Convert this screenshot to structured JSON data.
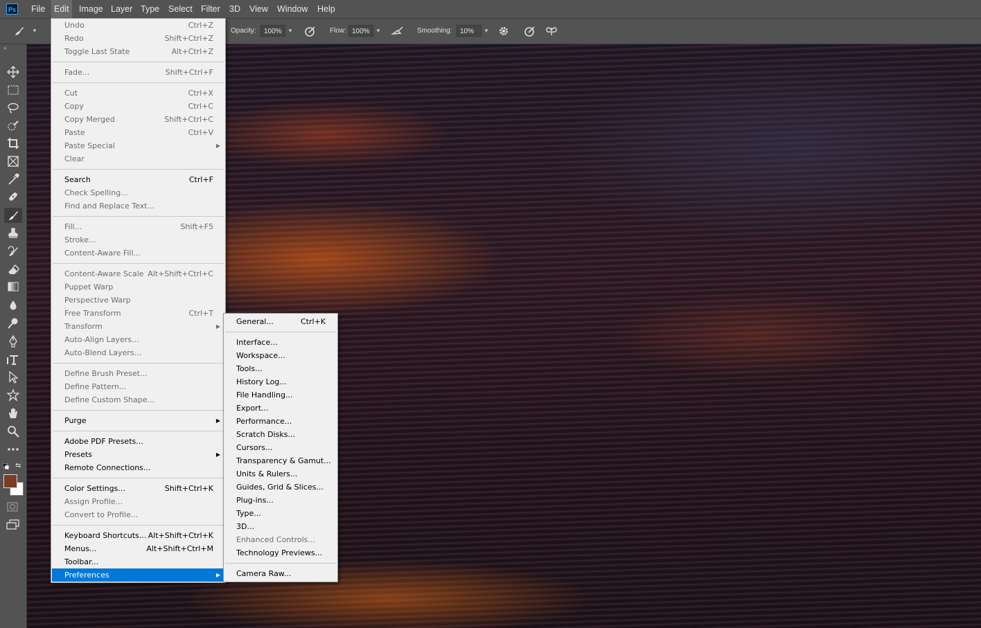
{
  "app": {
    "logo": "Ps"
  },
  "menubar": [
    "File",
    "Edit",
    "Image",
    "Layer",
    "Type",
    "Select",
    "Filter",
    "3D",
    "View",
    "Window",
    "Help"
  ],
  "options": {
    "opacity_label": "Opacity:",
    "opacity_value": "100%",
    "flow_label": "Flow:",
    "flow_value": "100%",
    "smoothing_label": "Smoothing:",
    "smoothing_value": "10%"
  },
  "edit_menu": [
    {
      "label": "Undo",
      "shortcut": "Ctrl+Z",
      "disabled": true
    },
    {
      "label": "Redo",
      "shortcut": "Shift+Ctrl+Z",
      "disabled": true
    },
    {
      "label": "Toggle Last State",
      "shortcut": "Alt+Ctrl+Z",
      "disabled": true
    },
    {
      "sep": true
    },
    {
      "label": "Fade...",
      "shortcut": "Shift+Ctrl+F",
      "disabled": true
    },
    {
      "sep": true
    },
    {
      "label": "Cut",
      "shortcut": "Ctrl+X",
      "disabled": true
    },
    {
      "label": "Copy",
      "shortcut": "Ctrl+C",
      "disabled": true
    },
    {
      "label": "Copy Merged",
      "shortcut": "Shift+Ctrl+C",
      "disabled": true
    },
    {
      "label": "Paste",
      "shortcut": "Ctrl+V",
      "disabled": true
    },
    {
      "label": "Paste Special",
      "shortcut": "",
      "submenu": true,
      "disabled": true
    },
    {
      "label": "Clear",
      "shortcut": "",
      "disabled": true
    },
    {
      "sep": true
    },
    {
      "label": "Search",
      "shortcut": "Ctrl+F",
      "disabled": false
    },
    {
      "label": "Check Spelling...",
      "shortcut": "",
      "disabled": true
    },
    {
      "label": "Find and Replace Text...",
      "shortcut": "",
      "disabled": true
    },
    {
      "sep": true
    },
    {
      "label": "Fill...",
      "shortcut": "Shift+F5",
      "disabled": true
    },
    {
      "label": "Stroke...",
      "shortcut": "",
      "disabled": true
    },
    {
      "label": "Content-Aware Fill...",
      "shortcut": "",
      "disabled": true
    },
    {
      "sep": true
    },
    {
      "label": "Content-Aware Scale",
      "shortcut": "Alt+Shift+Ctrl+C",
      "disabled": true
    },
    {
      "label": "Puppet Warp",
      "shortcut": "",
      "disabled": true
    },
    {
      "label": "Perspective Warp",
      "shortcut": "",
      "disabled": true
    },
    {
      "label": "Free Transform",
      "shortcut": "Ctrl+T",
      "disabled": true
    },
    {
      "label": "Transform",
      "shortcut": "",
      "submenu": true,
      "disabled": true
    },
    {
      "label": "Auto-Align Layers...",
      "shortcut": "",
      "disabled": true
    },
    {
      "label": "Auto-Blend Layers...",
      "shortcut": "",
      "disabled": true
    },
    {
      "sep": true
    },
    {
      "label": "Define Brush Preset...",
      "shortcut": "",
      "disabled": true
    },
    {
      "label": "Define Pattern...",
      "shortcut": "",
      "disabled": true
    },
    {
      "label": "Define Custom Shape...",
      "shortcut": "",
      "disabled": true
    },
    {
      "sep": true
    },
    {
      "label": "Purge",
      "shortcut": "",
      "submenu": true,
      "disabled": false
    },
    {
      "sep": true
    },
    {
      "label": "Adobe PDF Presets...",
      "shortcut": "",
      "disabled": false
    },
    {
      "label": "Presets",
      "shortcut": "",
      "submenu": true,
      "disabled": false
    },
    {
      "label": "Remote Connections...",
      "shortcut": "",
      "disabled": false
    },
    {
      "sep": true
    },
    {
      "label": "Color Settings...",
      "shortcut": "Shift+Ctrl+K",
      "disabled": false
    },
    {
      "label": "Assign Profile...",
      "shortcut": "",
      "disabled": true
    },
    {
      "label": "Convert to Profile...",
      "shortcut": "",
      "disabled": true
    },
    {
      "sep": true
    },
    {
      "label": "Keyboard Shortcuts...",
      "shortcut": "Alt+Shift+Ctrl+K",
      "disabled": false
    },
    {
      "label": "Menus...",
      "shortcut": "Alt+Shift+Ctrl+M",
      "disabled": false
    },
    {
      "label": "Toolbar...",
      "shortcut": "",
      "disabled": false
    },
    {
      "label": "Preferences",
      "shortcut": "",
      "submenu": true,
      "disabled": false,
      "highlighted": true
    }
  ],
  "prefs_menu": [
    {
      "label": "General...",
      "shortcut": "Ctrl+K",
      "disabled": false
    },
    {
      "sep": true
    },
    {
      "label": "Interface...",
      "shortcut": "",
      "disabled": false
    },
    {
      "label": "Workspace...",
      "shortcut": "",
      "disabled": false
    },
    {
      "label": "Tools...",
      "shortcut": "",
      "disabled": false
    },
    {
      "label": "History Log...",
      "shortcut": "",
      "disabled": false
    },
    {
      "label": "File Handling...",
      "shortcut": "",
      "disabled": false
    },
    {
      "label": "Export...",
      "shortcut": "",
      "disabled": false
    },
    {
      "label": "Performance...",
      "shortcut": "",
      "disabled": false
    },
    {
      "label": "Scratch Disks...",
      "shortcut": "",
      "disabled": false
    },
    {
      "label": "Cursors...",
      "shortcut": "",
      "disabled": false
    },
    {
      "label": "Transparency & Gamut...",
      "shortcut": "",
      "disabled": false
    },
    {
      "label": "Units & Rulers...",
      "shortcut": "",
      "disabled": false
    },
    {
      "label": "Guides, Grid & Slices...",
      "shortcut": "",
      "disabled": false
    },
    {
      "label": "Plug-ins...",
      "shortcut": "",
      "disabled": false
    },
    {
      "label": "Type...",
      "shortcut": "",
      "disabled": false
    },
    {
      "label": "3D...",
      "shortcut": "",
      "disabled": false
    },
    {
      "label": "Enhanced Controls...",
      "shortcut": "",
      "disabled": true
    },
    {
      "label": "Technology Previews...",
      "shortcut": "",
      "disabled": false
    },
    {
      "sep": true
    },
    {
      "label": "Camera Raw...",
      "shortcut": "",
      "disabled": false
    }
  ],
  "tools": [
    "move-tool",
    "marquee-tool",
    "lasso-tool",
    "quick-select-tool",
    "crop-tool",
    "frame-tool",
    "eyedropper-tool",
    "healing-brush-tool",
    "brush-tool",
    "clone-stamp-tool",
    "history-brush-tool",
    "eraser-tool",
    "gradient-tool",
    "blur-tool",
    "dodge-tool",
    "pen-tool",
    "type-tool",
    "path-select-tool",
    "shape-tool",
    "hand-tool",
    "zoom-tool",
    "more-tools"
  ],
  "colors": {
    "foreground": "#7a3c24",
    "background": "#ffffff",
    "highlight": "#0078d7"
  }
}
